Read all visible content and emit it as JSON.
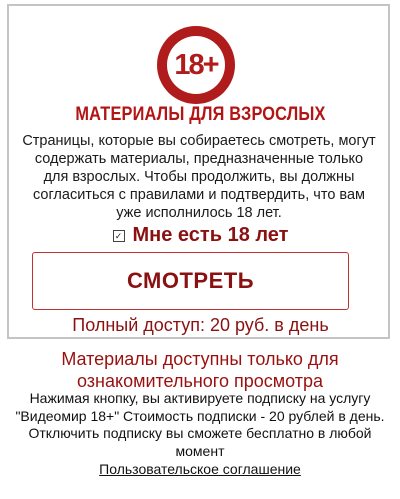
{
  "badge": {
    "text": "18+"
  },
  "card": {
    "title": "МАТЕРИАЛЫ ДЛЯ ВЗРОСЛЫХ",
    "description": "Страницы, которые вы собираетесь смотреть, могут содержать материалы, предназначенные только для взрослых. Чтобы продолжить, вы должны согласиться с правилами и подтвердить, что вам уже исполнилось 18 лет.",
    "checkbox_label": "Мне есть 18 лет",
    "checkbox_checked": true,
    "watch_button": "СМОТРЕТЬ",
    "price_text": "Полный доступ: 20 руб. в день"
  },
  "footer": {
    "availability": "Материалы доступны только для ознакомительного просмотра",
    "terms": "Нажимая кнопку, вы активируете подписку на услугу \"Видеомир 18+\" Стоимость подписки - 20 рублей в день. Отключить подписку вы сможете бесплатно в любой момент",
    "agreement_link": "Пользовательское соглашение"
  },
  "colors": {
    "accent": "#b01b1b",
    "dark_red": "#8a1111"
  }
}
